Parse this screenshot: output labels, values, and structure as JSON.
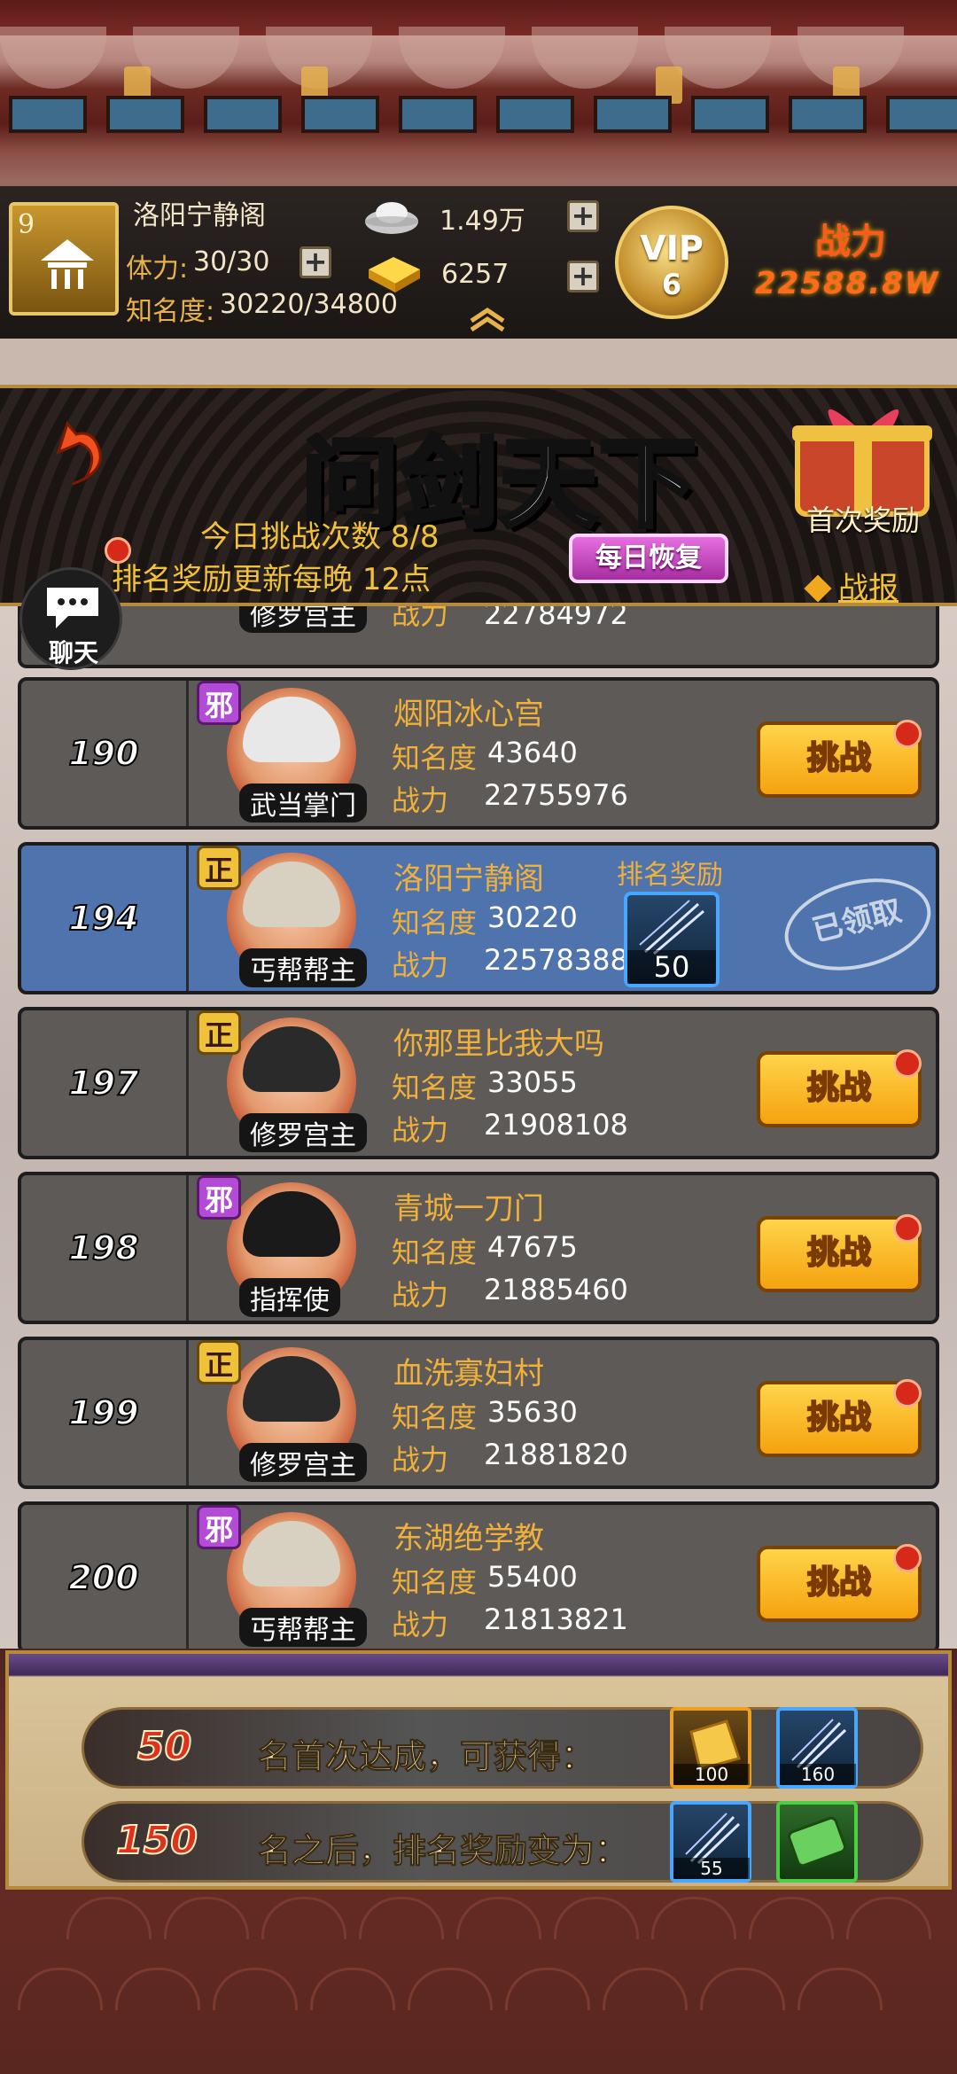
{
  "header": {
    "level": "9",
    "guild_name": "洛阳宁静阁",
    "stamina_label": "体力:",
    "stamina_value": "30/30",
    "fame_label": "知名度:",
    "fame_value": "30220/34800",
    "silver_value": "1.49万",
    "gold_value": "6257",
    "vip_label": "VIP",
    "vip_level": "6",
    "power_label": "战力",
    "power_value": "22588.8W"
  },
  "banner": {
    "title": "问剑天下",
    "challenge_count": "今日挑战次数 8/8",
    "reward_update": "排名奖励更新每晚 12点",
    "daily_restore": "每日恢复",
    "first_reward": "首次奖励",
    "battle_report": "战报",
    "chat": "聊天"
  },
  "partial_row": {
    "title": "修罗宫主",
    "power_label": "战力",
    "power_value": "22784972"
  },
  "rows": [
    {
      "rank": "190",
      "align": "邪",
      "title": "武当掌门",
      "name": "烟阳冰心宫",
      "fame_label": "知名度",
      "fame": "43640",
      "power_label": "战力",
      "power": "22755976",
      "button": "挑战"
    },
    {
      "rank": "194",
      "align": "正",
      "title": "丐帮帮主",
      "name": "洛阳宁静阁",
      "fame_label": "知名度",
      "fame": "30220",
      "power_label": "战力",
      "power": "22578388",
      "reward_label": "排名奖励",
      "reward_qty": "50",
      "stamp": "已领取"
    },
    {
      "rank": "197",
      "align": "正",
      "title": "修罗宫主",
      "name": "你那里比我大吗",
      "fame_label": "知名度",
      "fame": "33055",
      "power_label": "战力",
      "power": "21908108",
      "button": "挑战"
    },
    {
      "rank": "198",
      "align": "邪",
      "title": "指挥使",
      "name": "青城一刀门",
      "fame_label": "知名度",
      "fame": "47675",
      "power_label": "战力",
      "power": "21885460",
      "button": "挑战"
    },
    {
      "rank": "199",
      "align": "正",
      "title": "修罗宫主",
      "name": "血洗寡妇村",
      "fame_label": "知名度",
      "fame": "35630",
      "power_label": "战力",
      "power": "21881820",
      "button": "挑战"
    },
    {
      "rank": "200",
      "align": "邪",
      "title": "丐帮帮主",
      "name": "东湖绝学教",
      "fame_label": "知名度",
      "fame": "55400",
      "power_label": "战力",
      "power": "21813821",
      "button": "挑战"
    }
  ],
  "bottom": {
    "line1_rank": "50",
    "line1_text": "名首次达成，可获得：",
    "line1_items": [
      "100",
      "160"
    ],
    "line2_rank": "150",
    "line2_text": "名之后，排名奖励变为：",
    "line2_items": [
      "55",
      ""
    ]
  },
  "colors": {
    "accent_gold": "#f0b03c",
    "row_bg": "#5d5a58",
    "row_highlight": "#4e73ad",
    "challenge_button": "#f5a20e",
    "evil_badge": "#b44ad8",
    "good_badge": "#f0c23a"
  },
  "icons": [
    "silver-ingot-icon",
    "gold-ingot-icon",
    "plus-icon",
    "vip-badge-icon",
    "back-arrow-icon",
    "gift-box-icon",
    "chat-bubble-icon",
    "sword-item-icon",
    "gold-bar-item-icon",
    "green-token-item-icon",
    "chevron-up-icon"
  ]
}
